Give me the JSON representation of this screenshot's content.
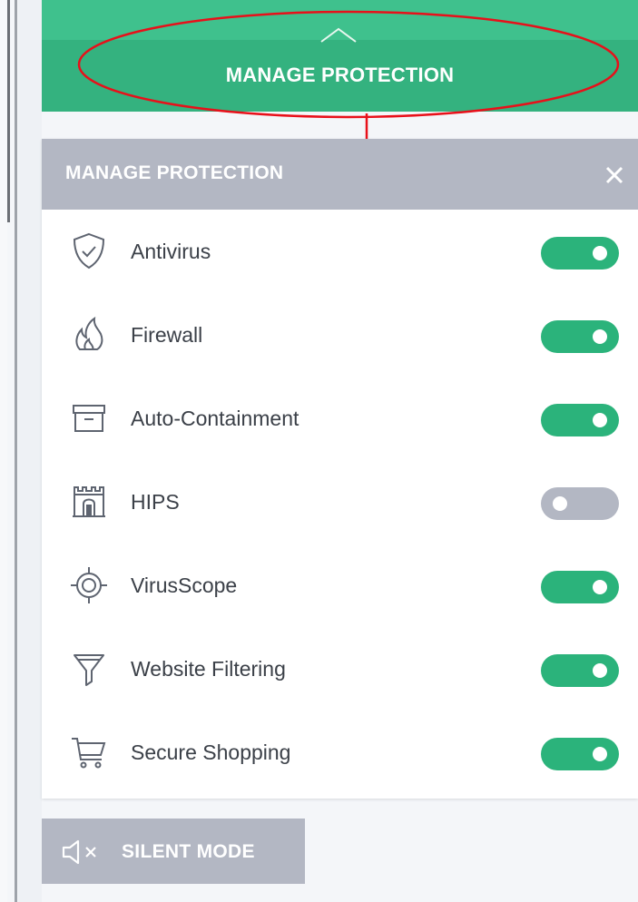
{
  "top_bar": {
    "label": "MANAGE PROTECTION",
    "icon": "chevron-up-icon",
    "color": "#34b27f"
  },
  "panel": {
    "title": "MANAGE PROTECTION",
    "close_icon": "close-icon",
    "header_color": "#b3b7c3",
    "items": [
      {
        "label": "Antivirus",
        "icon": "shield-check-icon",
        "enabled": true
      },
      {
        "label": "Firewall",
        "icon": "fire-icon",
        "enabled": true
      },
      {
        "label": "Auto-Containment",
        "icon": "container-box-icon",
        "enabled": true
      },
      {
        "label": "HIPS",
        "icon": "castle-gate-icon",
        "enabled": false
      },
      {
        "label": "VirusScope",
        "icon": "target-icon",
        "enabled": true
      },
      {
        "label": "Website Filtering",
        "icon": "funnel-icon",
        "enabled": true
      },
      {
        "label": "Secure Shopping",
        "icon": "shopping-cart-icon",
        "enabled": true
      }
    ]
  },
  "silent_mode": {
    "label": "SILENT MODE",
    "icon": "speaker-mute-icon"
  },
  "colors": {
    "toggle_on": "#2bb37b",
    "toggle_off": "#b3b7c3",
    "annotation": "#e8101a"
  }
}
